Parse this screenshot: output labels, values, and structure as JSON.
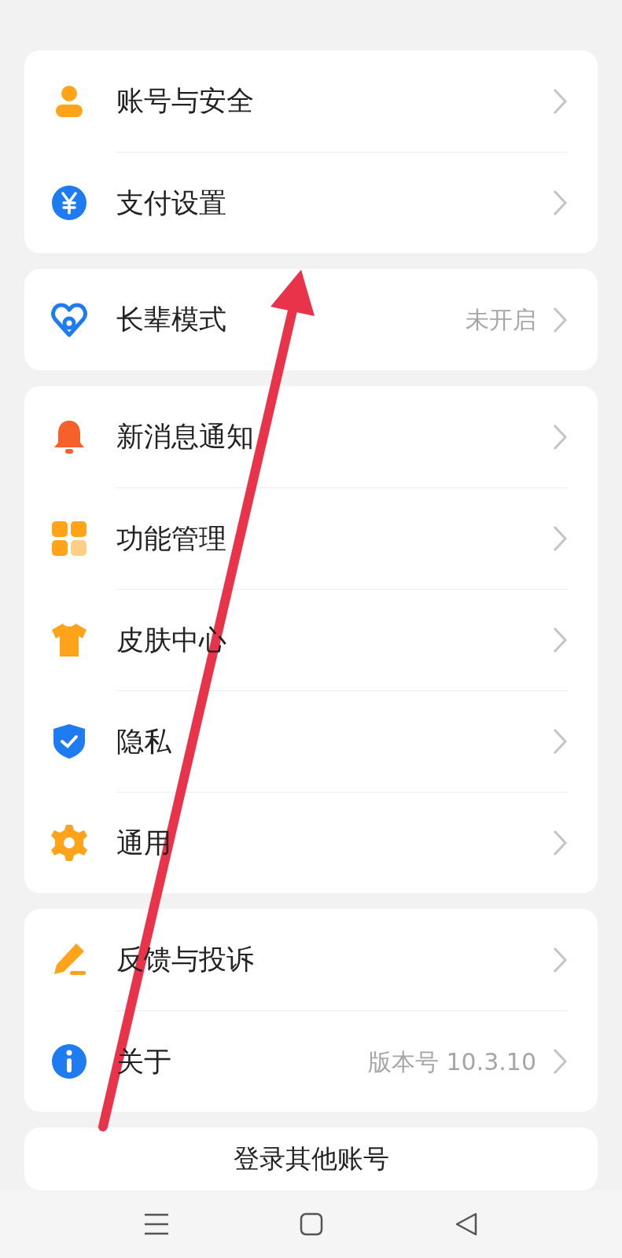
{
  "sections": [
    {
      "items": [
        {
          "label": "账号与安全"
        },
        {
          "label": "支付设置"
        }
      ]
    },
    {
      "items": [
        {
          "label": "长辈模式",
          "value": "未开启"
        }
      ]
    },
    {
      "items": [
        {
          "label": "新消息通知"
        },
        {
          "label": "功能管理"
        },
        {
          "label": "皮肤中心"
        },
        {
          "label": "隐私"
        },
        {
          "label": "通用"
        }
      ]
    },
    {
      "items": [
        {
          "label": "反馈与投诉"
        },
        {
          "label": "关于",
          "value": "版本号 10.3.10"
        }
      ]
    }
  ],
  "buttons": [
    "登录其他账号"
  ]
}
